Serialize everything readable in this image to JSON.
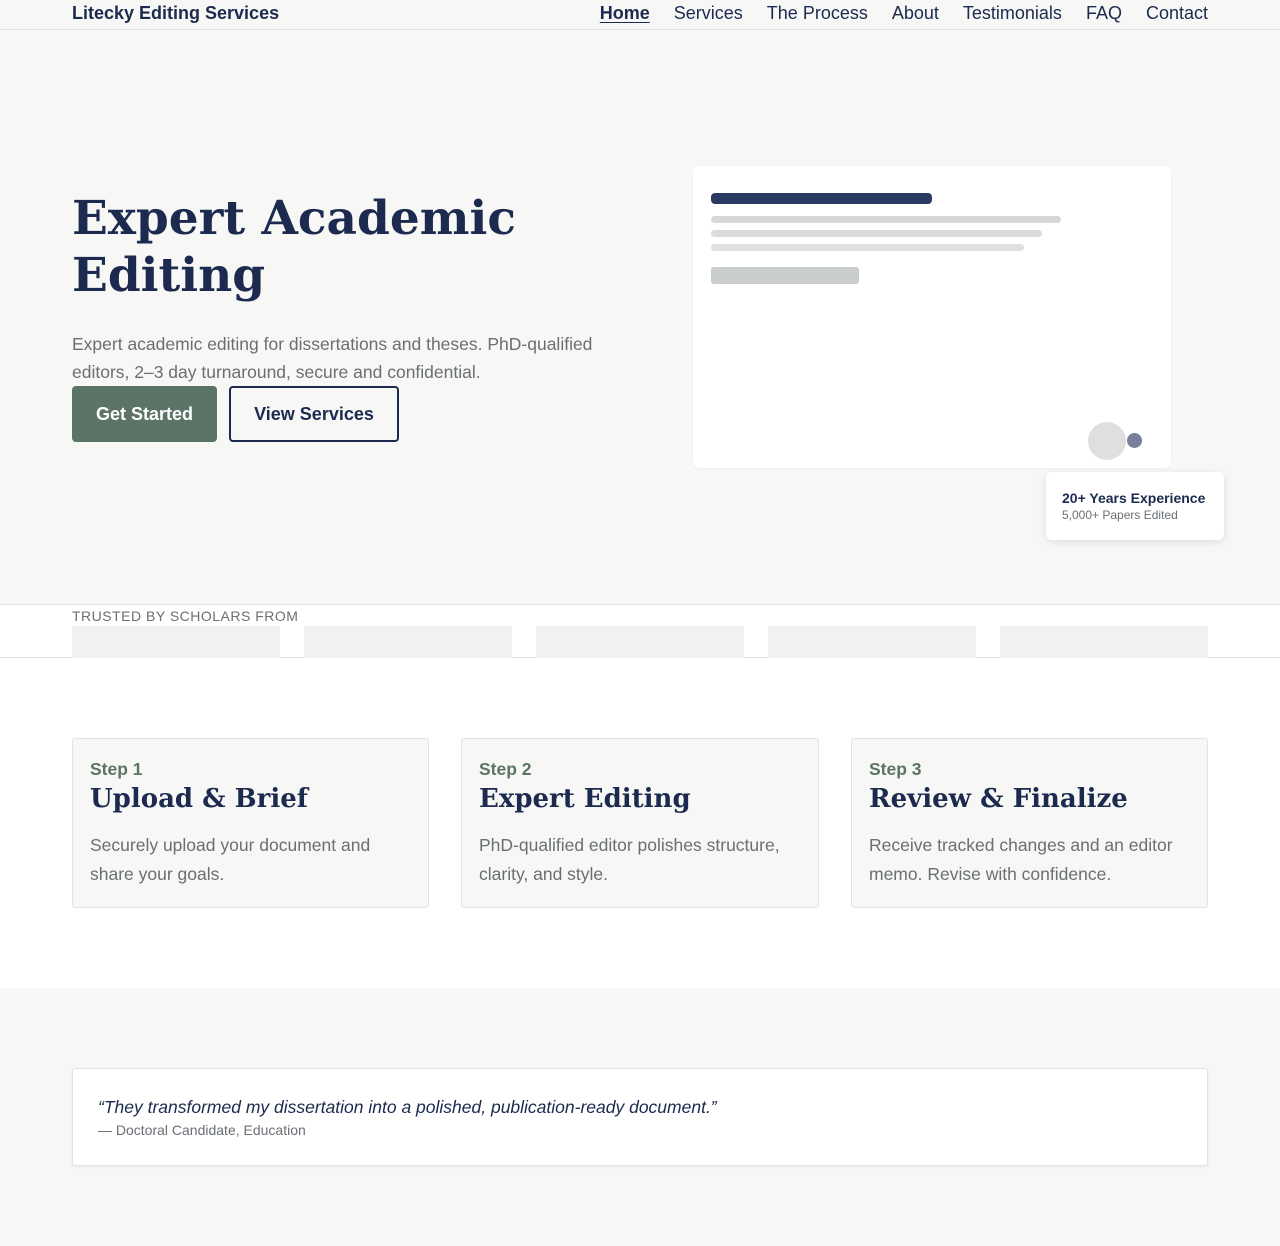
{
  "nav": {
    "brand": "Litecky Editing Services",
    "links": [
      {
        "label": "Home",
        "active": true
      },
      {
        "label": "Services"
      },
      {
        "label": "The Process"
      },
      {
        "label": "About"
      },
      {
        "label": "Testimonials"
      },
      {
        "label": "FAQ"
      },
      {
        "label": "Contact"
      }
    ]
  },
  "hero": {
    "title": "Expert Academic Editing",
    "subtitle": "Expert academic editing for dissertations and theses. PhD-qualified editors, 2–3 day turnaround, secure and confidential.",
    "primary_button": "Get Started",
    "secondary_button": "View Services"
  },
  "badge": {
    "title": "20+ Years Experience",
    "subtitle": "5,000+ Papers Edited"
  },
  "trusted": {
    "label": "TRUSTED BY SCHOLARS FROM"
  },
  "steps": [
    {
      "number": "Step 1",
      "title": "Upload & Brief",
      "description": "Securely upload your document and share your goals."
    },
    {
      "number": "Step 2",
      "title": "Expert Editing",
      "description": "PhD-qualified editor polishes structure, clarity, and style."
    },
    {
      "number": "Step 3",
      "title": "Review & Finalize",
      "description": "Receive tracked changes and an editor memo. Revise with confidence."
    }
  ],
  "testimonial": {
    "quote": "“They transformed my dissertation into a polished, publication-ready document.”",
    "attribution": "— Doctoral Candidate, Education"
  },
  "colors": {
    "navy": "#1b2a4e",
    "sage": "#5c7468",
    "muted_text": "#6a6f74",
    "background": "#f7f7f5"
  }
}
